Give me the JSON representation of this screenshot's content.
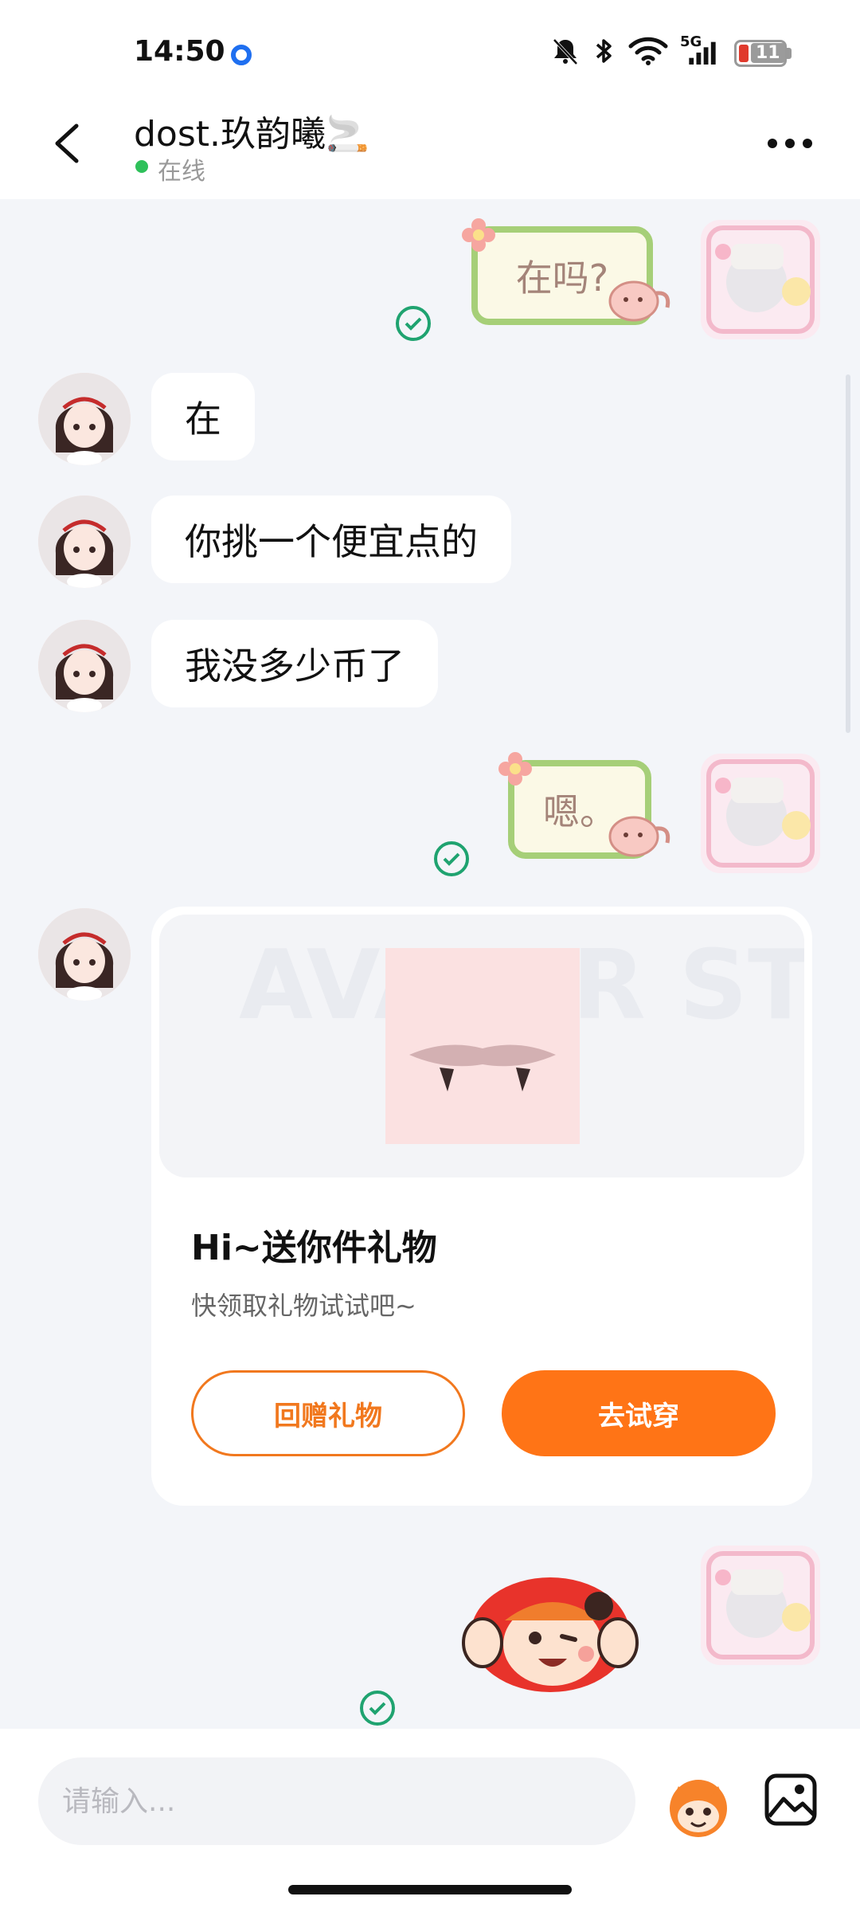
{
  "status_bar": {
    "time": "14:50",
    "battery": "11",
    "network": "5G",
    "icons": [
      "location-icon",
      "mute-bell-icon",
      "bluetooth-icon",
      "wifi-icon",
      "signal-icon",
      "battery-icon"
    ]
  },
  "header": {
    "title": "dost.玖韵曦🚬",
    "status": "在线",
    "back_icon": "chevron-left-icon",
    "more_icon": "more-dots-icon"
  },
  "messages": [
    {
      "from": "self",
      "type": "sticker-text",
      "text": "在吗?",
      "read": true
    },
    {
      "from": "peer",
      "type": "text",
      "text": "在"
    },
    {
      "from": "peer",
      "type": "text",
      "text": "你挑一个便宜点的"
    },
    {
      "from": "peer",
      "type": "text",
      "text": "我没多少币了"
    },
    {
      "from": "self",
      "type": "sticker-text",
      "text": "嗯。",
      "read": true
    },
    {
      "from": "peer",
      "type": "gift-card"
    },
    {
      "from": "self",
      "type": "sticker",
      "read": true
    }
  ],
  "gift_card": {
    "title": "Hi~送你件礼物",
    "subtitle": "快领取礼物试试吧~",
    "watermark": "AVATAR STORE",
    "return_button": "回赠礼物",
    "try_button": "去试穿"
  },
  "input_bar": {
    "placeholder": "请输入...",
    "emoji_icon": "emoji-sticker-icon",
    "gallery_icon": "image-gallery-icon"
  },
  "colors": {
    "accent": "#ff7416",
    "read_check": "#1fa370",
    "online": "#2ec05a",
    "sticker_border": "#a6cf78"
  }
}
